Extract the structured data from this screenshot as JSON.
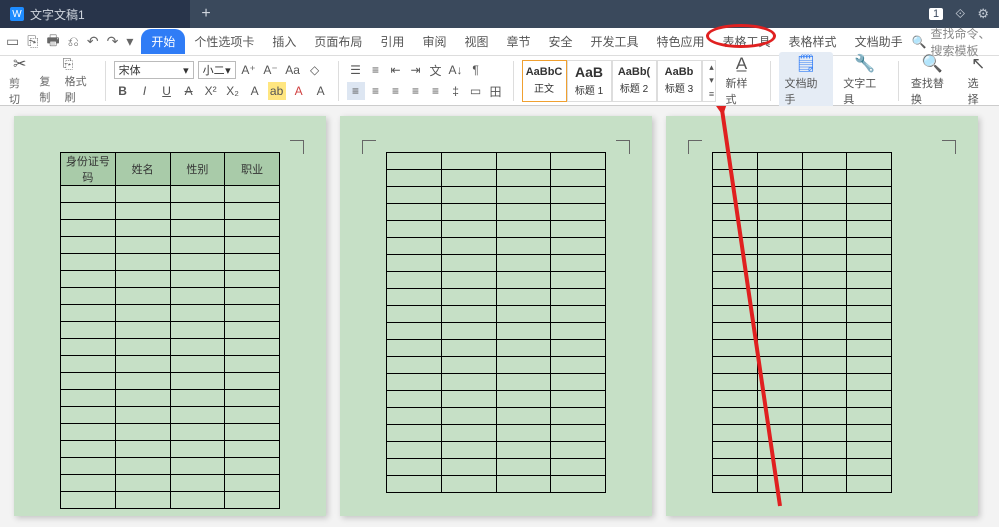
{
  "titlebar": {
    "doc_title": "文字文稿1",
    "badge": "1"
  },
  "menus": {
    "start": "开始",
    "items": [
      "个性选项卡",
      "插入",
      "页面布局",
      "引用",
      "审阅",
      "视图",
      "章节",
      "安全",
      "开发工具",
      "特色应用",
      "表格工具",
      "表格样式",
      "文档助手"
    ],
    "circled_index": 10
  },
  "search": {
    "placeholder": "查找命令、搜索模板"
  },
  "ribbon": {
    "cut": "剪切",
    "copy": "复制",
    "format_painter": "格式刷",
    "font_name": "宋体",
    "font_size": "小二",
    "styles": [
      {
        "preview": "AaBbC",
        "label": "正文"
      },
      {
        "preview": "AaB",
        "label": "标题 1"
      },
      {
        "preview": "AaBb(",
        "label": "标题 2"
      },
      {
        "preview": "AaBb",
        "label": "标题 3"
      }
    ],
    "new_style": "新样式",
    "doc_helper": "文档助手",
    "text_tool": "文字工具",
    "find_replace": "查找替换",
    "select": "选择"
  },
  "table": {
    "headers": [
      "身份证号码",
      "姓名",
      "性别",
      "职业"
    ]
  }
}
